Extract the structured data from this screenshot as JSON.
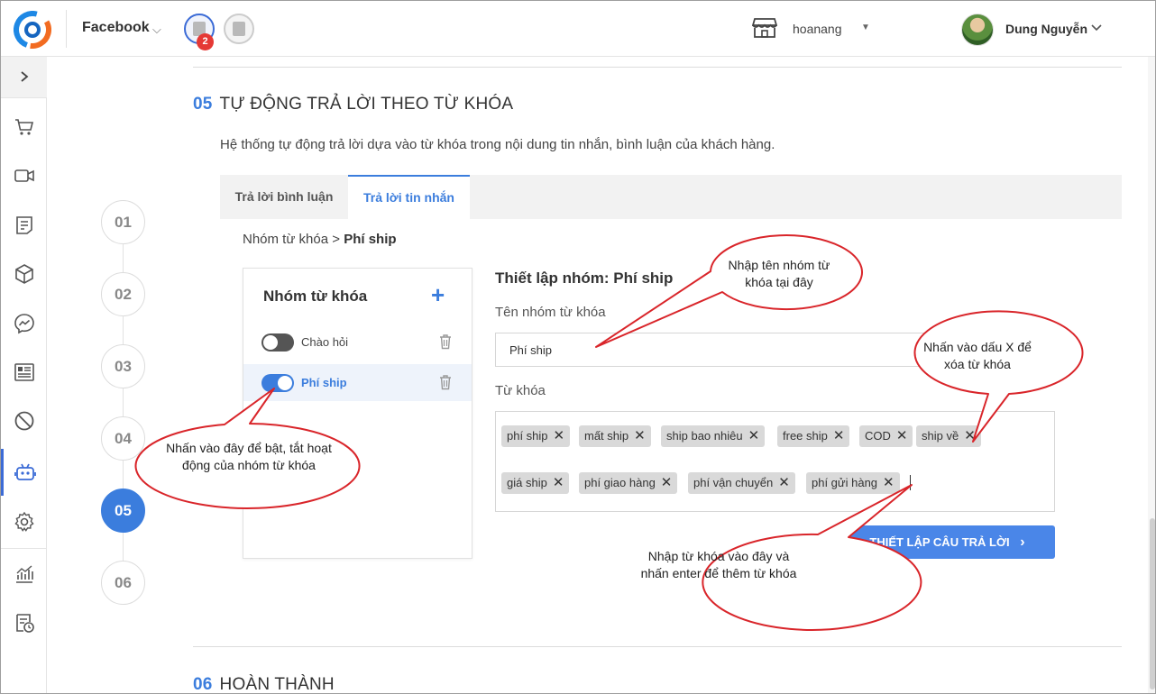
{
  "header": {
    "channel": "Facebook",
    "shop_badge": "2",
    "store_name": "hoanang",
    "user_name": "Dung Nguyễn"
  },
  "sidebar": {
    "items": [
      {
        "icon": "cart-icon"
      },
      {
        "icon": "video-icon"
      },
      {
        "icon": "order-list-icon"
      },
      {
        "icon": "box-icon"
      },
      {
        "icon": "messenger-icon"
      },
      {
        "icon": "customer-card-icon"
      },
      {
        "icon": "block-icon"
      },
      {
        "icon": "bot-icon",
        "active": true
      },
      {
        "icon": "gear-icon"
      },
      {
        "icon": "stats-icon"
      },
      {
        "icon": "report-clock-icon"
      }
    ]
  },
  "section5": {
    "number": "05",
    "title": "TỰ ĐỘNG TRẢ LỜI THEO TỪ KHÓA",
    "description": "Hệ thống tự động trả lời dựa vào từ khóa trong nội dung tin nhắn, bình luận của khách hàng.",
    "tabs": [
      "Trả lời bình luận",
      "Trả lời tin nhắn"
    ],
    "active_tab": "Trả lời tin nhắn"
  },
  "breadcrumb": {
    "parent": "Nhóm từ khóa",
    "separator": ">",
    "current": "Phí ship"
  },
  "steps": [
    "01",
    "02",
    "03",
    "04",
    "05",
    "06"
  ],
  "active_step": "05",
  "groups": {
    "title": "Nhóm từ khóa",
    "add_symbol": "+",
    "items": [
      {
        "label": "Chào hỏi",
        "enabled": false
      },
      {
        "label": "Phí ship",
        "enabled": true,
        "selected": true
      }
    ]
  },
  "config": {
    "title": "Thiết lập nhóm: Phí ship",
    "name_label": "Tên nhóm từ khóa",
    "name_value": "Phí ship",
    "keywords_label": "Từ khóa",
    "keywords": [
      "phí ship",
      "mất ship",
      "ship bao nhiêu",
      "free ship",
      "COD",
      "ship về",
      "giá ship",
      "phí giao hàng",
      "phí vận chuyển",
      "phí gửi hàng"
    ],
    "remove_symbol": "✕",
    "button_label": "THIẾT LẬP CÂU TRẢ LỜI",
    "button_chevron": "›"
  },
  "callouts": {
    "group_name": "Nhập tên nhóm từ khóa tại đây",
    "remove_keyword": "Nhấn vào dấu X để xóa từ khóa",
    "toggle_group": "Nhấn vào đây để bật, tắt hoạt động của nhóm từ khóa",
    "add_keyword": "Nhập từ khóa vào đây và nhấn enter để thêm từ khóa"
  },
  "section6": {
    "number": "06",
    "title": "HOÀN THÀNH"
  },
  "colors": {
    "accent": "#3b7ddd",
    "button": "#4a86e8",
    "callout_border": "#e53935",
    "badge": "#e53935"
  }
}
